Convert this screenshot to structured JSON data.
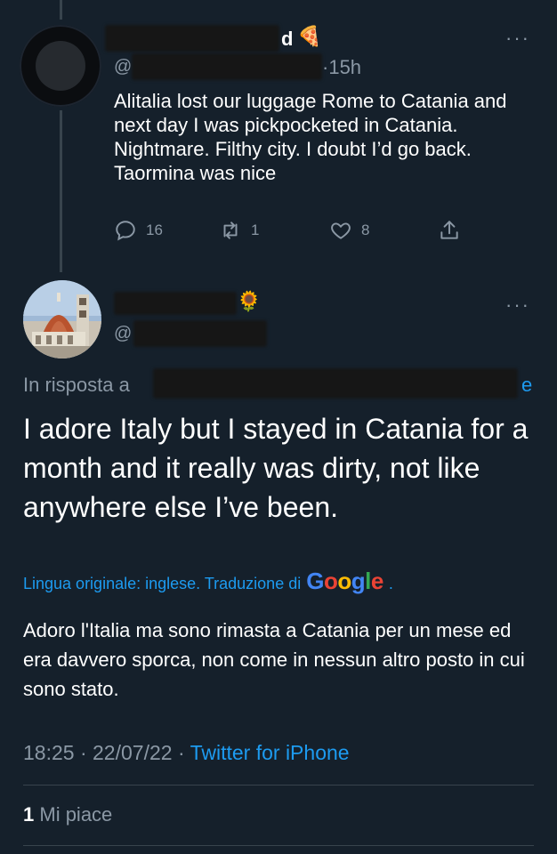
{
  "reply_tweet": {
    "name_visible_tail": "d",
    "name_emoji": "🍕",
    "handle_prefix": "@",
    "time": "15h",
    "text": "Alitalia lost our luggage Rome to Catania and next day I was pickpocketed in Catania. Nightmare.  Filthy city. I doubt I’d go back. Taormina was nice",
    "actions": {
      "reply_count": "16",
      "retweet_count": "1",
      "like_count": "8"
    }
  },
  "main_tweet": {
    "name_emoji": "🌻",
    "handle_prefix": "@",
    "in_reply_to_label": "In risposta a",
    "in_reply_to_tail": "e",
    "text": "I adore Italy but I stayed in Catania for a month and it really was dirty, not like anywhere else I’ve been.",
    "translation_notice": "Lingua originale: inglese. Traduzione di",
    "translation_provider": "Google",
    "translated_text": "Adoro l'Italia ma sono rimasta a Catania per un mese ed era davvero sporca, non come in nessun altro posto in cui sono stato.",
    "time": "18:25",
    "date": "22/07/22",
    "separator": "·",
    "client": "Twitter for iPhone",
    "likes_count": "1",
    "likes_label": "Mi piace"
  },
  "more_label": "···",
  "colors": {
    "background": "#15202b",
    "text": "#ffffff",
    "muted": "#8b98a5",
    "link": "#1d9bf0",
    "divider": "#38444d"
  }
}
